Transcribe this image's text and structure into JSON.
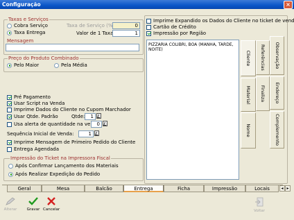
{
  "window": {
    "title": "Configuração",
    "close_glyph": "×"
  },
  "taxas": {
    "legend": "Taxas e Serviços",
    "cobra_servico": "Cobra Serviço",
    "taxa_entrega": "Taxa Entrega",
    "taxa_servico_label": "Taxa de Serviço (%)",
    "taxa_servico_value": "0",
    "valor_taxa_label": "Valor de 1 Taxa",
    "valor_taxa_value": "1"
  },
  "mensagem": {
    "legend": "Mensagem",
    "value": ""
  },
  "preco": {
    "legend": "Preço do Produto Combinado",
    "pelo_maior": "Pelo Maior",
    "pela_media": "Pela Média"
  },
  "options": {
    "pre_pagamento": "Pré Pagamento",
    "usar_script": "Usar Script na Venda",
    "imprime_dados": "Imprime Dados do Cliente no Cupom Marchador",
    "usar_qtde": "Usar Qtde. Padrão",
    "qtde_label": "Qtde:",
    "qtde_value": "1",
    "usa_alerta": "Usa alerta de quantidade na venda",
    "alerta_value": "0",
    "sequencia_label": "Sequência Inicial de Venda:",
    "sequencia_value": "1",
    "imprime_mensagem": "Imprime Mensagem de Primeiro Pedido do Cliente",
    "entrega_agendada": "Entrega Agendada"
  },
  "impressao": {
    "legend": "Impressão do Ticket na Impressora Fiscal",
    "apos_confirmar": "Após Confirmar Lançamento dos Materiais",
    "apos_realizar": "Após Realizar Expedição do Pedido"
  },
  "right": {
    "imprime_expandido": "Imprime Expandido os Dados do Cliente no ticket de venda",
    "cartao_credito": "Cartão de Crédito",
    "impressao_regiao": "Impressão por Região",
    "memo_text": "PIZZARIA COLIBRI, BOA (MANHA, TARDE, NOITE)"
  },
  "side_tabs": {
    "cliente": "Cliente",
    "referencias": "Referências",
    "observacao": "Observação",
    "material": "Material",
    "finaliza": "Finaliza",
    "endereco": "Endereço",
    "nome": "Nome",
    "complemento": "Complemento"
  },
  "bottom_tabs": [
    "Geral",
    "Mesa",
    "Balcão",
    "Entrega",
    "Ficha",
    "Impressão",
    "Locais Produç"
  ],
  "toolbar": {
    "alterar": "Alterar",
    "gravar": "Gravar",
    "cancelar": "Cancelar",
    "voltar": "Voltar"
  }
}
